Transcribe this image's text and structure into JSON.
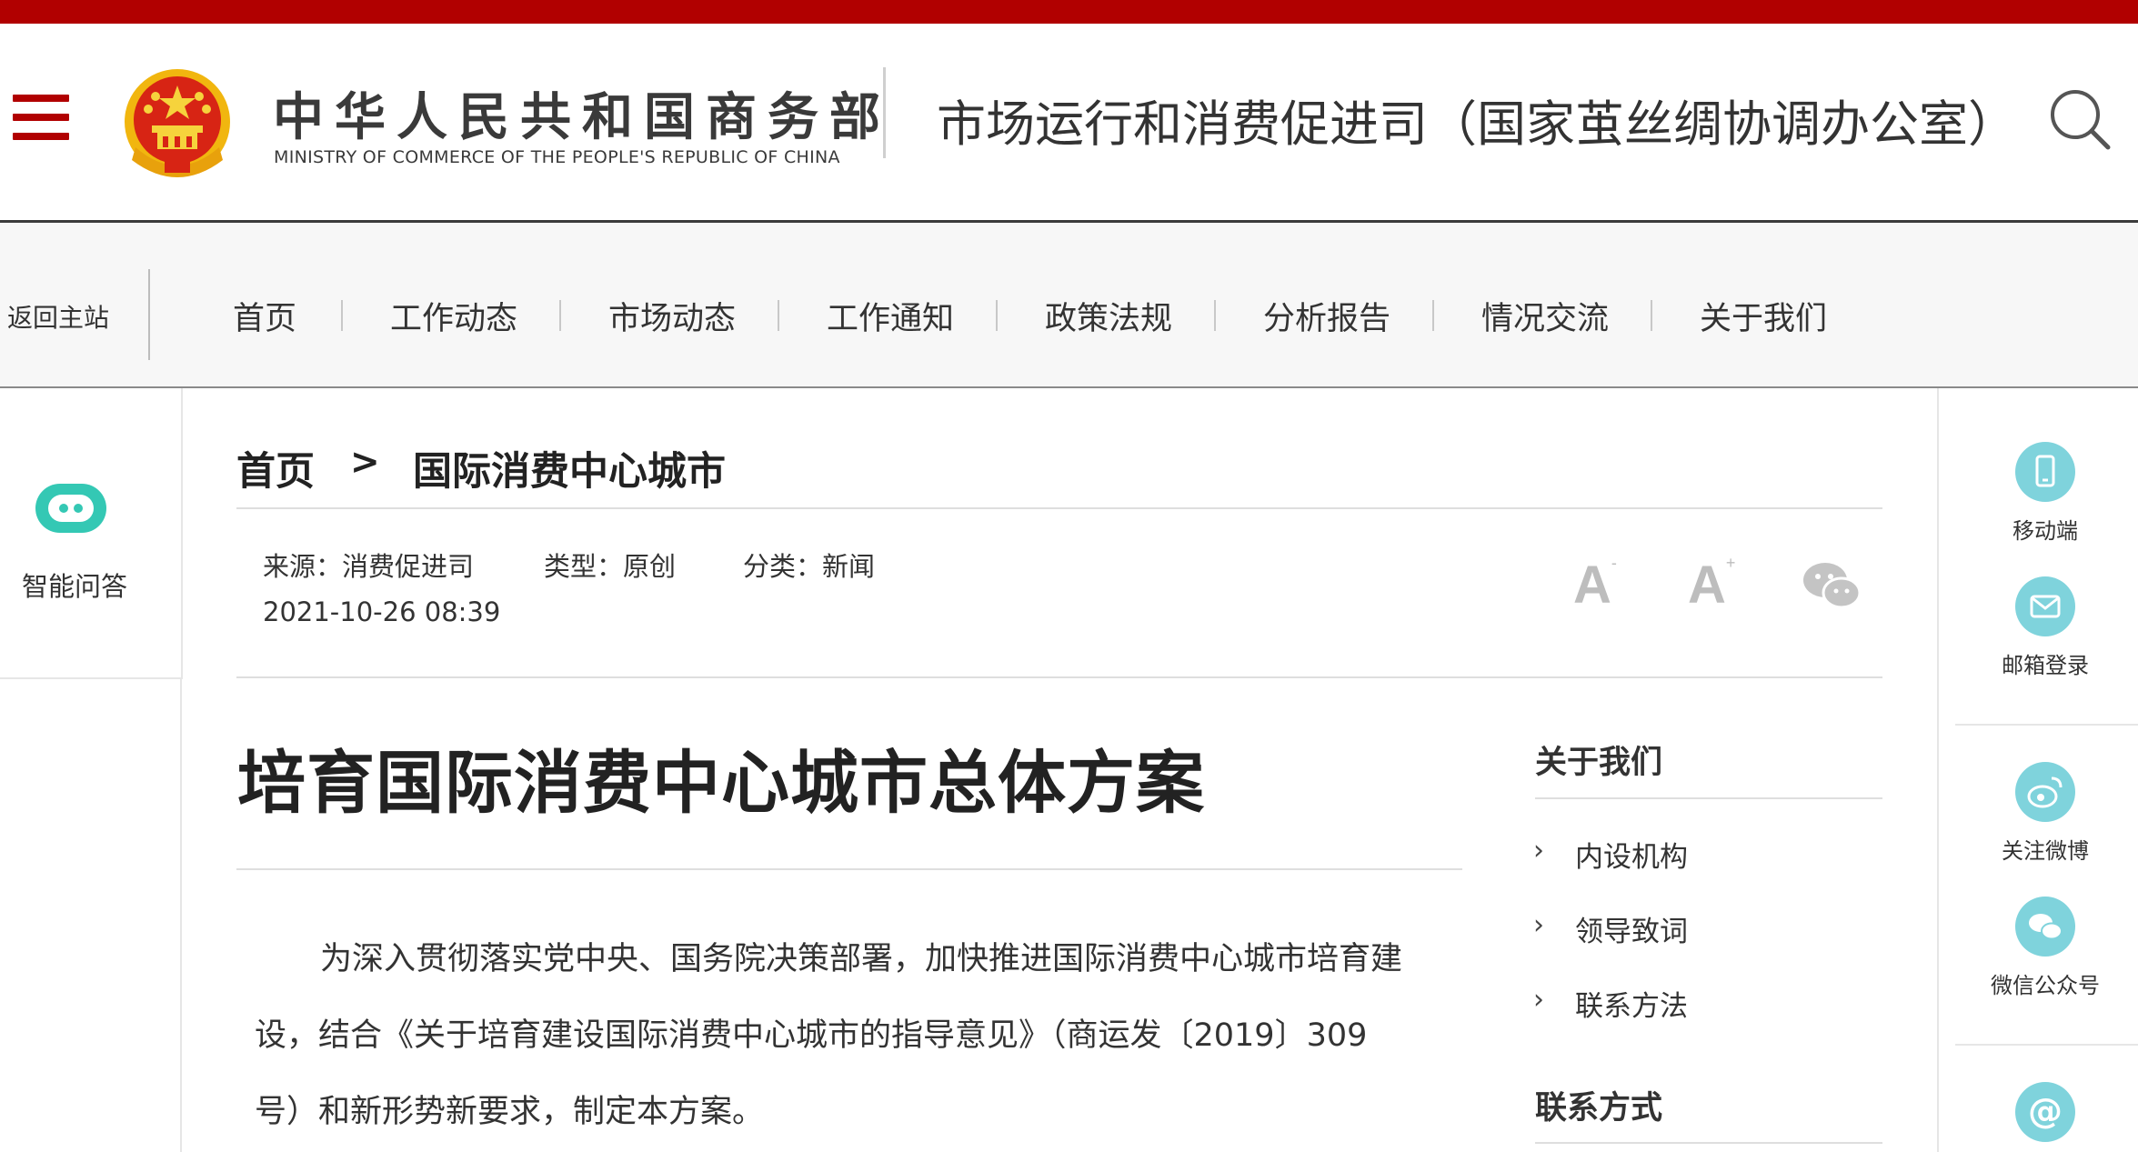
{
  "header": {
    "org_cn": "中华人民共和国商务部",
    "org_en": "MINISTRY OF COMMERCE OF THE PEOPLE'S REPUBLIC OF CHINA",
    "department": "市场运行和消费促进司（国家茧丝绸协调办公室）"
  },
  "nav": {
    "back_label": "返回主站",
    "items": [
      "首页",
      "工作动态",
      "市场动态",
      "工作通知",
      "政策法规",
      "分析报告",
      "情况交流",
      "关于我们"
    ]
  },
  "left_panel": {
    "assistant_label": "智能问答"
  },
  "right_panel": {
    "items": [
      {
        "label": "移动端",
        "icon": "mobile-icon"
      },
      {
        "label": "邮箱登录",
        "icon": "mail-icon"
      },
      {
        "label": "关注微博",
        "icon": "weibo-icon"
      },
      {
        "label": "微信公众号",
        "icon": "wechat-icon"
      },
      {
        "label": "",
        "icon": "at-icon"
      }
    ]
  },
  "breadcrumb": {
    "home": "首页",
    "separator": ">",
    "current": "国际消费中心城市"
  },
  "meta": {
    "source": "来源：消费促进司",
    "type": "类型：原创",
    "category": "分类：新闻",
    "datetime": "2021-10-26 08:39",
    "font_small": "A",
    "font_small_mark": "-",
    "font_large": "A",
    "font_large_mark": "+"
  },
  "article": {
    "title": "培育国际消费中心城市总体方案",
    "para_line1": "为深入贯彻落实党中央、国务院决策部署，加快推进国际消费中心城市培育建",
    "para_line2": "设，结合《关于培育建设国际消费中心城市的指导意见》（商运发〔2019〕309",
    "para_line3": "号）和新形势新要求，制定本方案。"
  },
  "sidebar": {
    "about_title": "关于我们",
    "about_links": [
      "内设机构",
      "领导致词",
      "联系方法"
    ],
    "contact_title": "联系方式"
  },
  "colors": {
    "brand_red": "#b10000",
    "icon_teal": "#7fd3dc",
    "text": "#333333"
  }
}
